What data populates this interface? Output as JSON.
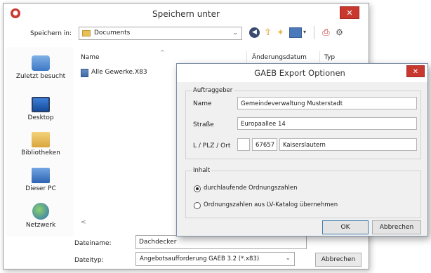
{
  "save_dialog": {
    "title": "Speichern unter",
    "save_in_label": "Speichern in:",
    "folder": "Documents",
    "places": [
      "Zuletzt besucht",
      "Desktop",
      "Bibliotheken",
      "Dieser PC",
      "Netzwerk"
    ],
    "columns": {
      "name": "Name",
      "date": "Änderungsdatum",
      "type": "Typ"
    },
    "files": [
      {
        "name": "Alle Gewerke.X83"
      }
    ],
    "filename_label": "Dateiname:",
    "filename_value": "Dachdecker",
    "filetype_label": "Dateityp:",
    "filetype_value": "Angebotsaufforderung GAEB 3.2 (*.x83)",
    "cancel_label": "Abbrechen"
  },
  "gaeb_dialog": {
    "title": "GAEB Export Optionen",
    "client_group": "Auftraggeber",
    "name_label": "Name",
    "name_value": "Gemeindeverwaltung Musterstadt",
    "street_label": "Straße",
    "street_value": "Europaallee 14",
    "city_label": "L / PLZ / Ort",
    "country_value": "",
    "zip_value": "67657",
    "city_value": "Kaiserslautern",
    "content_group": "Inhalt",
    "option_continuous": "durchlaufende Ordnungszahlen",
    "option_catalog": "Ordnungszahlen aus LV-Katalog übernehmen",
    "selected_option": "option_continuous",
    "ok_label": "OK",
    "cancel_label": "Abbrechen"
  },
  "colors": {
    "close_red": "#c8382e",
    "dialog_bg": "#f0f0f0",
    "folder_yellow": "#e7c05a"
  },
  "icons": [
    "app-icon",
    "close-icon",
    "folder-icon",
    "back-icon",
    "up-icon",
    "new-folder-icon",
    "view-icon",
    "print-icon",
    "properties-icon",
    "recent-places-icon",
    "desktop-icon",
    "libraries-icon",
    "this-pc-icon",
    "network-icon",
    "file-icon"
  ]
}
